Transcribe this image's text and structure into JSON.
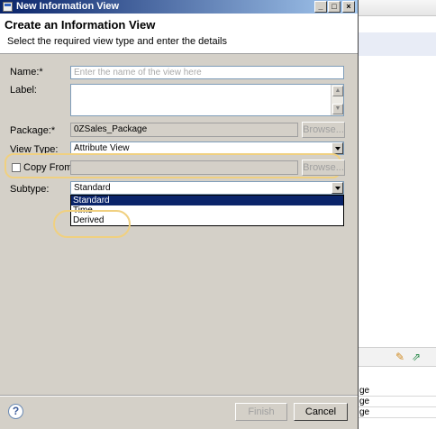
{
  "background": {
    "rows": [
      "ge",
      "ge",
      "ge"
    ]
  },
  "titlebar": {
    "title": "New Information View",
    "minimize": "_",
    "maximize": "□",
    "close": "×"
  },
  "header": {
    "title": "Create an Information View",
    "subtitle": "Select the required view type and enter the details"
  },
  "form": {
    "name_label": "Name:*",
    "name_placeholder": "Enter the name of the view here",
    "label_label": "Label:",
    "package_label": "Package:*",
    "package_value": "0ZSales_Package",
    "browse_label": "Browse...",
    "view_type_label": "View Type:",
    "view_type_value": "Attribute View",
    "copy_from_label": "Copy From:",
    "copy_from_browse": "Browse...",
    "subtype_label": "Subtype:",
    "subtype_value": "Standard",
    "subtype_options": [
      "Standard",
      "Time",
      "Derived"
    ]
  },
  "footer": {
    "help": "?",
    "finish_label": "Finish",
    "cancel_label": "Cancel"
  },
  "colors": {
    "titlebar_start": "#0a246a",
    "titlebar_end": "#a6caf0",
    "selection": "#0a246a",
    "highlight": "#f0d080",
    "dialog_bg": "#d4d0c8"
  }
}
